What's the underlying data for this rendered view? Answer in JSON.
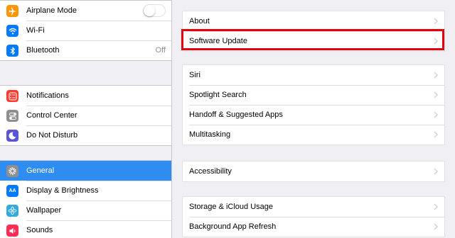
{
  "sidebar": {
    "group1": {
      "airplane_label": "Airplane Mode",
      "wifi_label": "Wi-Fi",
      "bluetooth_label": "Bluetooth",
      "bluetooth_value": "Off"
    },
    "group2": {
      "notifications_label": "Notifications",
      "control_center_label": "Control Center",
      "dnd_label": "Do Not Disturb"
    },
    "group3": {
      "general_label": "General",
      "display_label": "Display & Brightness",
      "display_icon_text": "AA",
      "wallpaper_label": "Wallpaper",
      "sounds_label": "Sounds"
    }
  },
  "detail": {
    "group1": {
      "about_label": "About",
      "software_update_label": "Software Update"
    },
    "group2": {
      "siri_label": "Siri",
      "spotlight_label": "Spotlight Search",
      "handoff_label": "Handoff & Suggested Apps",
      "multitasking_label": "Multitasking"
    },
    "group3": {
      "accessibility_label": "Accessibility"
    },
    "group4": {
      "storage_label": "Storage & iCloud Usage",
      "bg_refresh_label": "Background App Refresh"
    }
  },
  "colors": {
    "selected_row": "#2f8cf0",
    "highlight_box": "#e8000b",
    "airplane_icon": "#ff9500",
    "wifi_icon": "#007aff",
    "bluetooth_icon": "#007aff",
    "notifications_icon": "#ff3b30",
    "control_center_icon": "#8e8e93",
    "dnd_icon": "#5856d6"
  },
  "state": {
    "airplane_mode_on": false
  }
}
